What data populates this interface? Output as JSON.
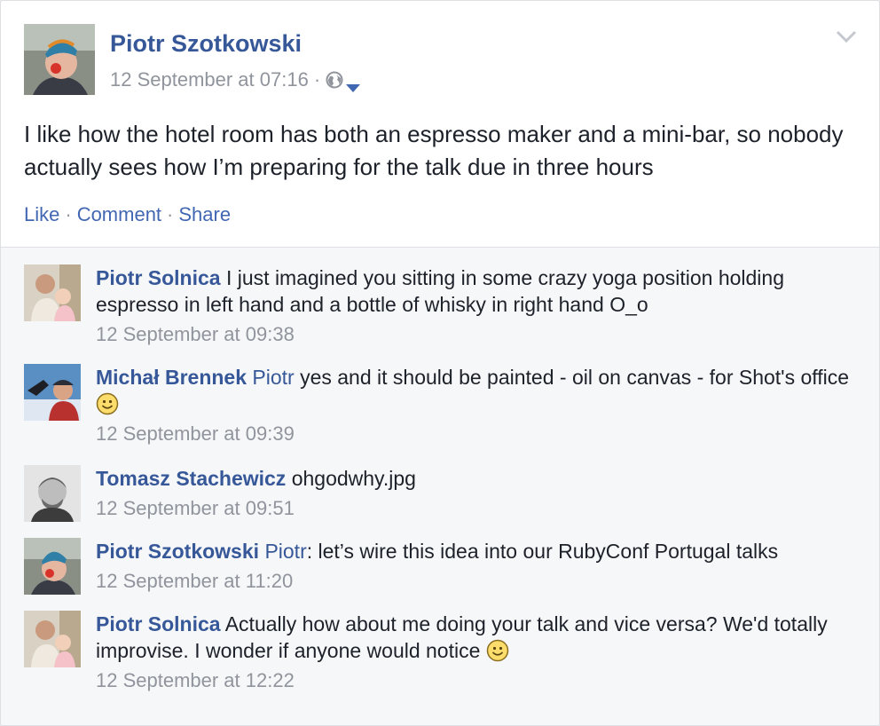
{
  "post": {
    "author": "Piotr Szotkowski",
    "timestamp": "12 September at 07:16",
    "separator": "·",
    "audience_icon": "globe-icon",
    "text": "I like how the hotel room has both an espresso maker and a mini-bar, so nobody actually sees how I’m preparing for the talk due in three hours",
    "actions": {
      "like": "Like",
      "comment": "Comment",
      "share": "Share",
      "dot": "·"
    }
  },
  "comments": [
    {
      "author": "Piotr Solnica",
      "mention": "",
      "text": "I just imagined you sitting in some crazy yoga position holding espresso in left hand and a bottle of whisky in right hand O_o",
      "smiley": false,
      "time": "12 September at 09:38"
    },
    {
      "author": "Michał Brennek",
      "mention": "Piotr",
      "text": "yes and it should be painted - oil on canvas - for Shot's office",
      "smiley": true,
      "time": "12 September at 09:39"
    },
    {
      "author": "Tomasz Stachewicz",
      "mention": "",
      "text": "ohgodwhy.jpg",
      "smiley": false,
      "time": "12 September at 09:51"
    },
    {
      "author": "Piotr Szotkowski",
      "mention": "Piotr",
      "text": ": let’s wire this idea into our RubyConf Portugal talks",
      "smiley": false,
      "time": "12 September at 11:20"
    },
    {
      "author": "Piotr Solnica",
      "mention": "",
      "text": "Actually how about me doing your talk and vice versa? We'd totally improvise. I wonder if anyone would notice",
      "smiley": true,
      "time": "12 September at 12:22"
    }
  ],
  "colors": {
    "link": "#365899",
    "action": "#4267b2",
    "meta": "#90949c",
    "comment_bg": "#f6f7f9"
  }
}
